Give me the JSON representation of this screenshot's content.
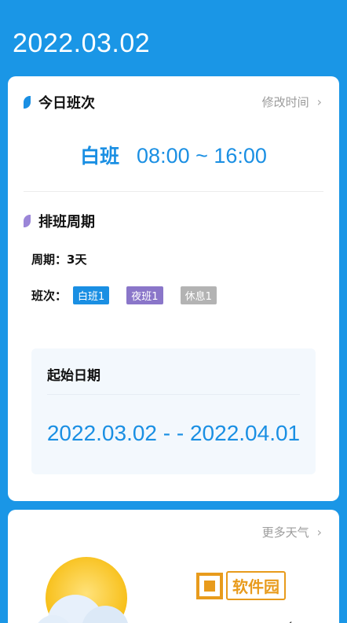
{
  "header": {
    "date": "2022.03.02"
  },
  "today_shift": {
    "title": "今日班次",
    "modify_label": "修改时间",
    "shift_name": "白班",
    "shift_time": "08:00 ~ 16:00"
  },
  "schedule": {
    "title": "排班周期",
    "cycle_label": "周期：",
    "cycle_value": "3天",
    "shifts_label": "班次：",
    "tags": [
      "白班1",
      "夜班1",
      "休息1"
    ],
    "start_title": "起始日期",
    "range": "2022.03.02 - - 2022.04.01"
  },
  "weather": {
    "more_label": "更多天气",
    "desc": "多云",
    "watermark": "软件园"
  },
  "colors": {
    "background": "#1a96e6",
    "accent": "#1a8fe3",
    "night_tag": "#8a76c9",
    "rest_tag": "#b3b3b3"
  }
}
